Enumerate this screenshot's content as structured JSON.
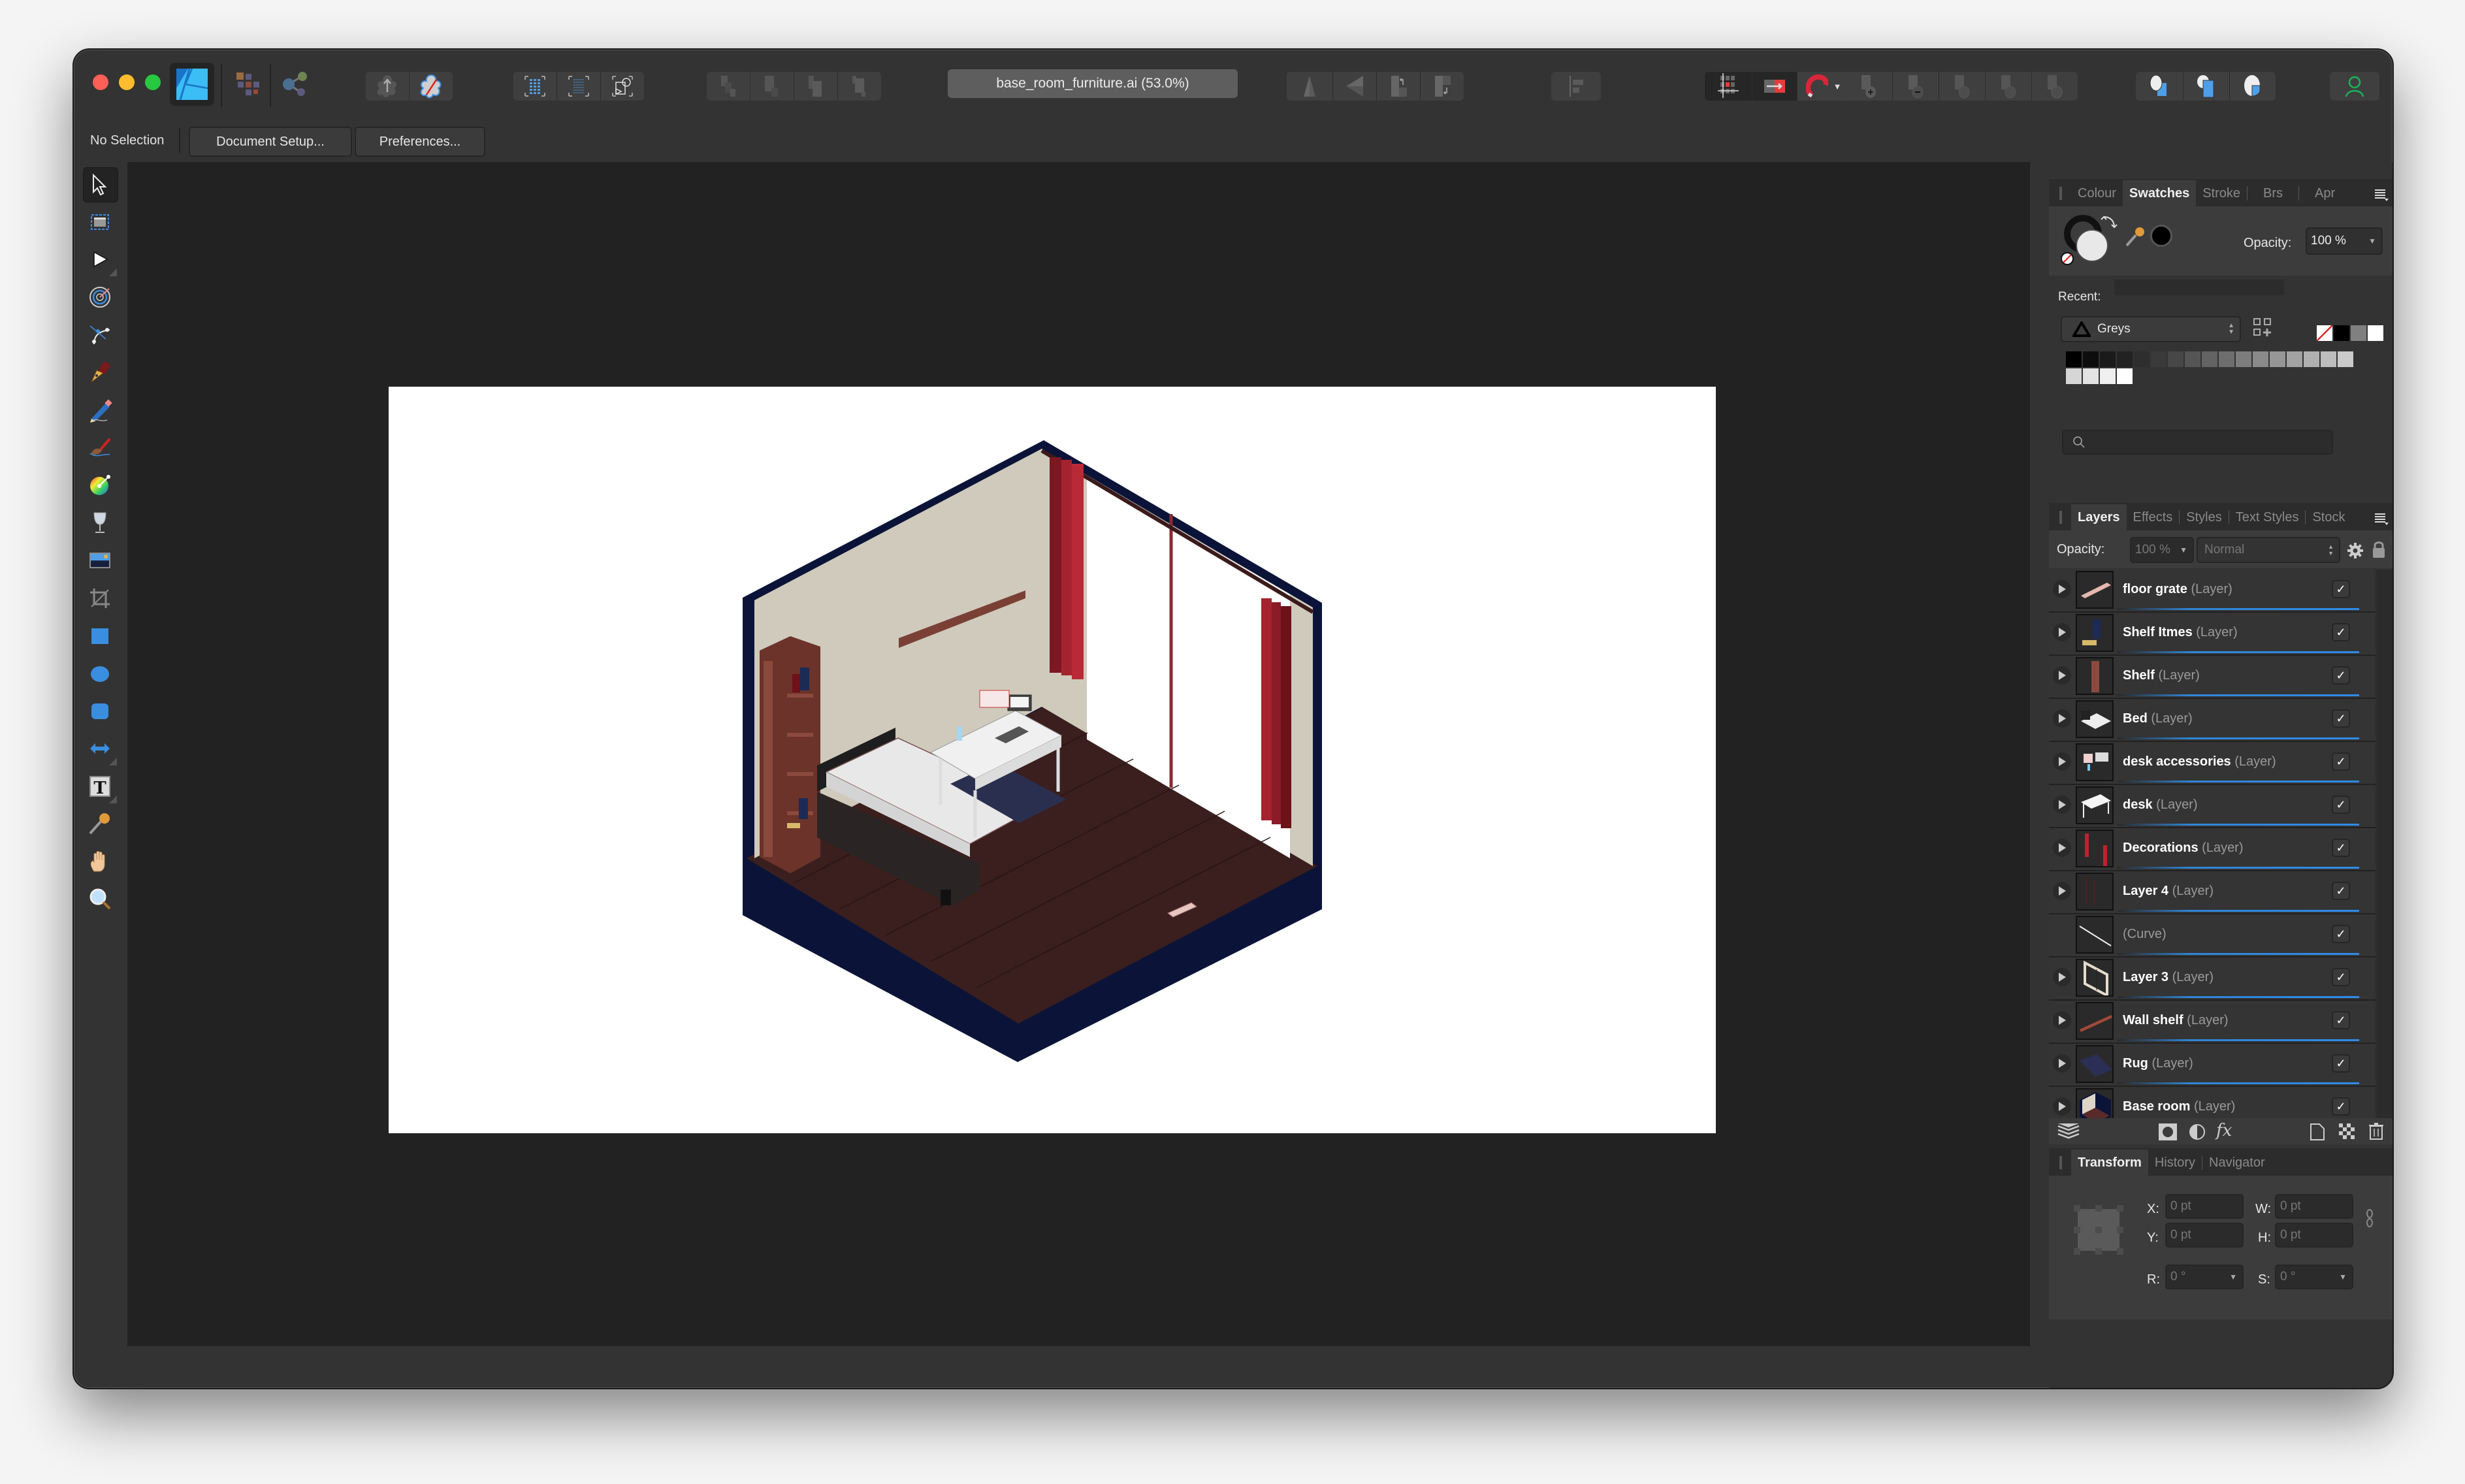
{
  "app": {
    "name": "Affinity Designer",
    "document_title": "base_room_furniture.ai (53.0%)",
    "zoom_level": "53.0%"
  },
  "toolbar": {
    "personas": [
      {
        "name": "designer-persona",
        "active": true
      },
      {
        "name": "pixel-persona",
        "active": false
      },
      {
        "name": "export-persona",
        "active": false
      }
    ],
    "groups": [
      {
        "name": "sync-group",
        "buttons": [
          "push-to-back-icon",
          "no-fill-icon"
        ]
      },
      {
        "name": "selection-group",
        "buttons": [
          "select-all-icon",
          "select-same-icon",
          "select-object-icon"
        ]
      },
      {
        "name": "arrange-group",
        "buttons": [
          "move-to-back-icon",
          "move-back-one-icon",
          "move-forward-one-icon",
          "move-to-front-icon"
        ]
      },
      {
        "name": "flip-rotate-group",
        "buttons": [
          "flip-horizontal-icon",
          "flip-vertical-icon",
          "rotate-left-icon",
          "rotate-right-icon"
        ]
      },
      {
        "name": "align-group",
        "buttons": [
          "align-icon"
        ]
      },
      {
        "name": "snapping-group",
        "buttons": [
          "grid-snap-icon",
          "force-pixel-icon",
          "snapping-magnet-icon"
        ]
      },
      {
        "name": "boolean-group",
        "buttons": [
          "add-icon",
          "subtract-icon",
          "intersect-icon",
          "xor-icon",
          "divide-icon"
        ]
      },
      {
        "name": "insertion-group",
        "buttons": [
          "insert-behind-icon",
          "insert-top-icon",
          "insert-inside-icon"
        ]
      },
      {
        "name": "account-group",
        "buttons": [
          "user-account-icon"
        ]
      }
    ]
  },
  "context_bar": {
    "selection_label": "No Selection",
    "buttons": [
      "Document Setup...",
      "Preferences..."
    ]
  },
  "tools": [
    {
      "name": "move-tool",
      "icon": "pointer-arrow-icon",
      "active": true
    },
    {
      "name": "artboard-tool",
      "icon": "artboard-icon"
    },
    {
      "name": "node-tool",
      "icon": "node-arrow-icon",
      "has_flyout": true
    },
    {
      "name": "corner-tool",
      "icon": "target-icon"
    },
    {
      "name": "point-transform-tool",
      "icon": "bezier-node-icon"
    },
    {
      "name": "pen-tool",
      "icon": "pen-nib-icon"
    },
    {
      "name": "pencil-tool",
      "icon": "pencil-icon"
    },
    {
      "name": "vector-brush-tool",
      "icon": "brush-icon"
    },
    {
      "name": "fill-tool",
      "icon": "color-wheel-icon"
    },
    {
      "name": "transparency-tool",
      "icon": "wine-glass-icon"
    },
    {
      "name": "place-image-tool",
      "icon": "image-icon"
    },
    {
      "name": "vector-crop-tool",
      "icon": "crop-icon"
    },
    {
      "name": "rectangle-tool",
      "icon": "rectangle-icon"
    },
    {
      "name": "ellipse-tool",
      "icon": "ellipse-icon"
    },
    {
      "name": "rounded-rectangle-tool",
      "icon": "rounded-rectangle-icon"
    },
    {
      "name": "arrow-shape-tool",
      "icon": "double-arrow-icon",
      "has_flyout": true
    },
    {
      "name": "artistic-text-tool",
      "icon": "text-t-icon",
      "has_flyout": true
    },
    {
      "name": "color-picker-tool",
      "icon": "eyedropper-icon"
    },
    {
      "name": "view-tool",
      "icon": "hand-icon"
    },
    {
      "name": "zoom-tool",
      "icon": "magnifier-icon"
    }
  ],
  "swatches_panel": {
    "tabs": [
      "Colour",
      "Swatches",
      "Stroke",
      "Brs",
      "Apr"
    ],
    "active_tab": "Swatches",
    "opacity_label": "Opacity:",
    "opacity_value": "100 %",
    "recent_label": "Recent:",
    "palette_name": "Greys",
    "fill_color": "#e8e8e8",
    "stroke_color": "#000000",
    "quick_swatches": [
      "none",
      "#000000",
      "#808080",
      "#ffffff"
    ],
    "palette": [
      "#000000",
      "#0d0d0d",
      "#1a1a1a",
      "#222222",
      "#2e2e2e",
      "#3a3a3a",
      "#474747",
      "#555555",
      "#636363",
      "#6e6e6e",
      "#7d7d7d",
      "#8a8a8a",
      "#969696",
      "#a3a3a3",
      "#b0b0b0",
      "#bdbdbd",
      "#cacaca",
      "#d6d6d6",
      "#e3e3e3",
      "#efefef",
      "#ffffff"
    ],
    "search_placeholder": ""
  },
  "layers_panel": {
    "tabs": [
      "Layers",
      "Effects",
      "Styles",
      "Text Styles",
      "Stock"
    ],
    "active_tab": "Layers",
    "opacity_label": "Opacity:",
    "opacity_value": "100 %",
    "blend_mode": "Normal",
    "layers": [
      {
        "name": "floor grate",
        "kind": "(Layer)",
        "visible": true,
        "expandable": true,
        "thumb": "grate"
      },
      {
        "name": "Shelf Itmes",
        "kind": "(Layer)",
        "visible": true,
        "expandable": true,
        "thumb": "books"
      },
      {
        "name": "Shelf",
        "kind": "(Layer)",
        "visible": true,
        "expandable": true,
        "thumb": "shelf"
      },
      {
        "name": "Bed",
        "kind": "(Layer)",
        "visible": true,
        "expandable": true,
        "thumb": "bed"
      },
      {
        "name": "desk accessories",
        "kind": "(Layer)",
        "visible": true,
        "expandable": true,
        "thumb": "accessories"
      },
      {
        "name": "desk",
        "kind": "(Layer)",
        "visible": true,
        "expandable": true,
        "thumb": "desk"
      },
      {
        "name": "Decorations",
        "kind": "(Layer)",
        "visible": true,
        "expandable": true,
        "thumb": "curtains"
      },
      {
        "name": "Layer 4",
        "kind": "(Layer)",
        "visible": true,
        "expandable": true,
        "thumb": "lines"
      },
      {
        "name": "",
        "kind": "(Curve)",
        "visible": true,
        "expandable": false,
        "thumb": "curve"
      },
      {
        "name": "Layer 3",
        "kind": "(Layer)",
        "visible": true,
        "expandable": true,
        "thumb": "window"
      },
      {
        "name": "Wall shelf",
        "kind": "(Layer)",
        "visible": true,
        "expandable": true,
        "thumb": "wallshelf"
      },
      {
        "name": "Rug",
        "kind": "(Layer)",
        "visible": true,
        "expandable": true,
        "thumb": "rug"
      },
      {
        "name": "Base room",
        "kind": "(Layer)",
        "visible": true,
        "expandable": true,
        "thumb": "room"
      }
    ],
    "footer_icons": [
      "layers-stack-icon",
      "mask-icon",
      "adjustment-icon",
      "fx-icon",
      "new-layer-icon",
      "pixel-layer-icon",
      "trash-icon"
    ]
  },
  "transform_panel": {
    "tabs": [
      "Transform",
      "History",
      "Navigator"
    ],
    "active_tab": "Transform",
    "fields": {
      "x": {
        "label": "X:",
        "value": "0 pt"
      },
      "y": {
        "label": "Y:",
        "value": "0 pt"
      },
      "w": {
        "label": "W:",
        "value": "0 pt"
      },
      "h": {
        "label": "H:",
        "value": "0 pt"
      },
      "r": {
        "label": "R:",
        "value": "0 °"
      },
      "s": {
        "label": "S:",
        "value": "0 °"
      }
    }
  },
  "colors": {
    "accent": "#2f8bea",
    "wall_navy": "#0b1438",
    "wall_beige": "#cfcabc",
    "floor": "#3a1f1e",
    "curtain_red": "#a5232e",
    "wood": "#7a4036"
  }
}
